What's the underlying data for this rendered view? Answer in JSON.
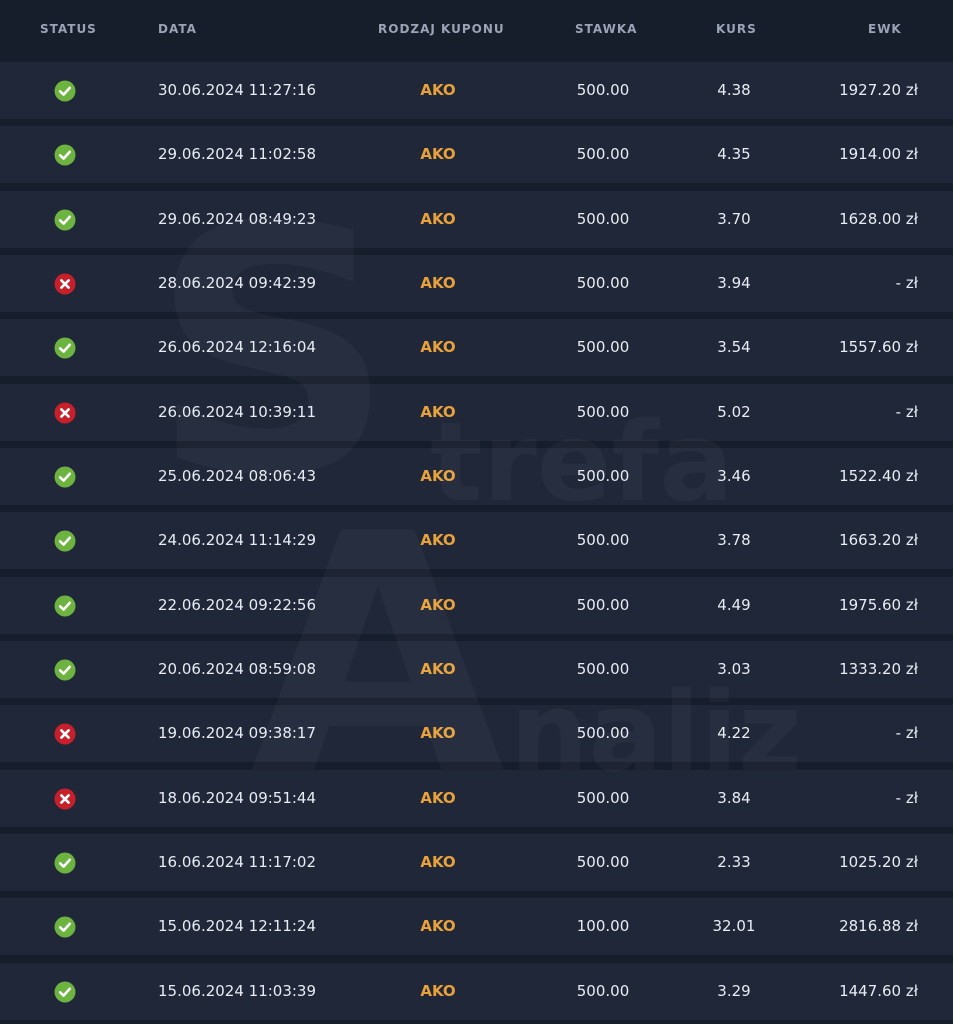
{
  "columns": {
    "status": "STATUS",
    "date": "DATA",
    "type": "RODZAJ KUPONU",
    "stake": "STAWKA",
    "odds": "KURS",
    "ewk": "EWK"
  },
  "colors": {
    "background": "#161d2b",
    "row": "#1f2738",
    "type_accent": "#e9a23b",
    "win": "#6cb33f",
    "loss": "#c8202a"
  },
  "rows": [
    {
      "status": "win",
      "date": "30.06.2024 11:27:16",
      "type": "AKO",
      "stake": "500.00",
      "odds": "4.38",
      "ewk": "1927.20 zł"
    },
    {
      "status": "win",
      "date": "29.06.2024 11:02:58",
      "type": "AKO",
      "stake": "500.00",
      "odds": "4.35",
      "ewk": "1914.00 zł"
    },
    {
      "status": "win",
      "date": "29.06.2024 08:49:23",
      "type": "AKO",
      "stake": "500.00",
      "odds": "3.70",
      "ewk": "1628.00 zł"
    },
    {
      "status": "loss",
      "date": "28.06.2024 09:42:39",
      "type": "AKO",
      "stake": "500.00",
      "odds": "3.94",
      "ewk": "- zł"
    },
    {
      "status": "win",
      "date": "26.06.2024 12:16:04",
      "type": "AKO",
      "stake": "500.00",
      "odds": "3.54",
      "ewk": "1557.60 zł"
    },
    {
      "status": "loss",
      "date": "26.06.2024 10:39:11",
      "type": "AKO",
      "stake": "500.00",
      "odds": "5.02",
      "ewk": "- zł"
    },
    {
      "status": "win",
      "date": "25.06.2024 08:06:43",
      "type": "AKO",
      "stake": "500.00",
      "odds": "3.46",
      "ewk": "1522.40 zł"
    },
    {
      "status": "win",
      "date": "24.06.2024 11:14:29",
      "type": "AKO",
      "stake": "500.00",
      "odds": "3.78",
      "ewk": "1663.20 zł"
    },
    {
      "status": "win",
      "date": "22.06.2024 09:22:56",
      "type": "AKO",
      "stake": "500.00",
      "odds": "4.49",
      "ewk": "1975.60 zł"
    },
    {
      "status": "win",
      "date": "20.06.2024 08:59:08",
      "type": "AKO",
      "stake": "500.00",
      "odds": "3.03",
      "ewk": "1333.20 zł"
    },
    {
      "status": "loss",
      "date": "19.06.2024 09:38:17",
      "type": "AKO",
      "stake": "500.00",
      "odds": "4.22",
      "ewk": "- zł"
    },
    {
      "status": "loss",
      "date": "18.06.2024 09:51:44",
      "type": "AKO",
      "stake": "500.00",
      "odds": "3.84",
      "ewk": "- zł"
    },
    {
      "status": "win",
      "date": "16.06.2024 11:17:02",
      "type": "AKO",
      "stake": "500.00",
      "odds": "2.33",
      "ewk": "1025.20 zł"
    },
    {
      "status": "win",
      "date": "15.06.2024 12:11:24",
      "type": "AKO",
      "stake": "100.00",
      "odds": "32.01",
      "ewk": "2816.88 zł"
    },
    {
      "status": "win",
      "date": "15.06.2024 11:03:39",
      "type": "AKO",
      "stake": "500.00",
      "odds": "3.29",
      "ewk": "1447.60 zł"
    }
  ],
  "watermark": {
    "logo_text": "Strefa Analiz"
  }
}
